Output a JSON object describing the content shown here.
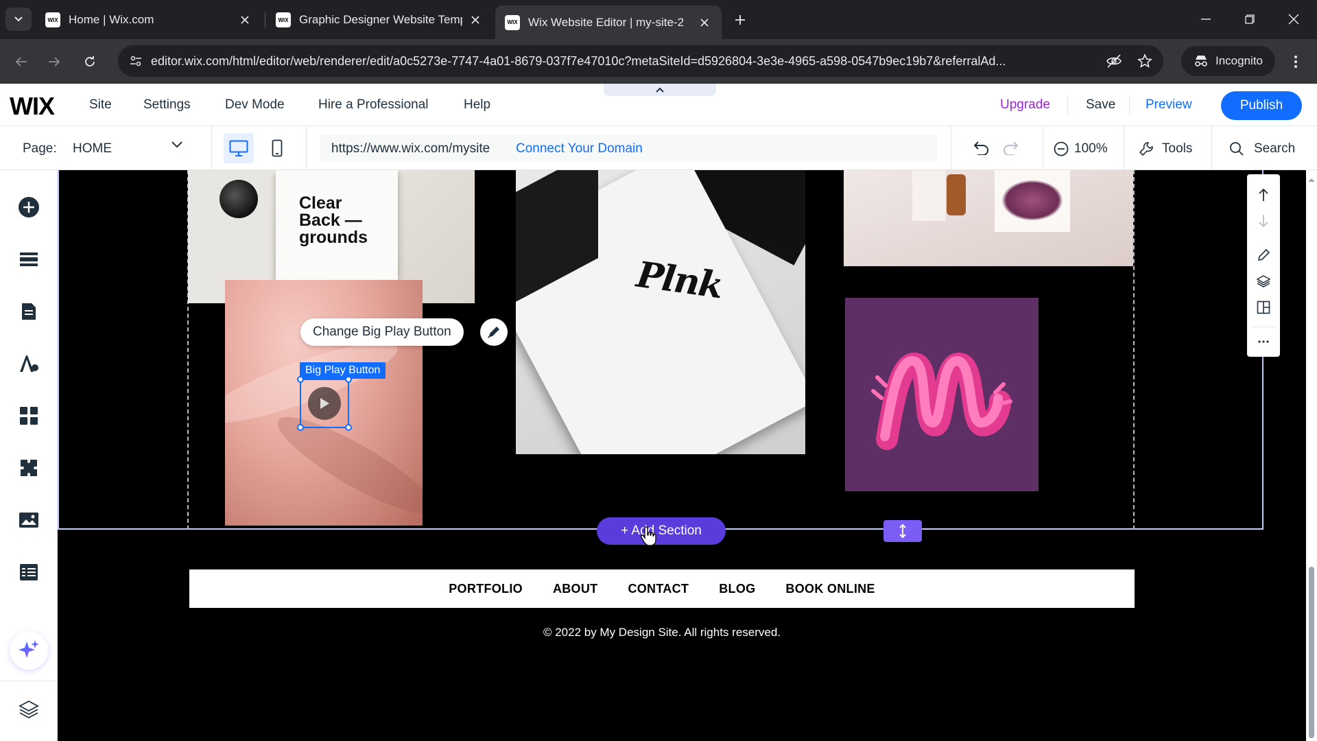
{
  "browser": {
    "tabs": [
      {
        "title": "Home | Wix.com",
        "favicon": "WIX"
      },
      {
        "title": "Graphic Designer Website Temp",
        "favicon": "WIX"
      },
      {
        "title": "Wix Website Editor | my-site-2",
        "favicon": "WIX"
      }
    ],
    "url": "editor.wix.com/html/editor/web/renderer/edit/a0c5273e-7747-4a01-8679-037f7e47010c?metaSiteId=d5926804-3e3e-4965-a598-0547b9ec19b7&referralAd...",
    "incognito_label": "Incognito"
  },
  "wix": {
    "logo": "WIX",
    "menu": [
      "Site",
      "Settings",
      "Dev Mode",
      "Hire a Professional",
      "Help"
    ],
    "upgrade": "Upgrade",
    "save": "Save",
    "preview": "Preview",
    "publish": "Publish"
  },
  "pagebar": {
    "page_label": "Page:",
    "page_name": "HOME",
    "site_url": "https://www.wix.com/mysite",
    "connect_domain": "Connect Your Domain",
    "zoom": "100%",
    "tools": "Tools",
    "search": "Search"
  },
  "canvas": {
    "image_text_clear": "Clear Back — grounds",
    "image_text_signature": "Plnk",
    "selected_element_label": "Big Play Button",
    "change_button_label": "Change Big Play Button",
    "add_section_label": "+ Add Section",
    "footer_nav": [
      "PORTFOLIO",
      "ABOUT",
      "CONTACT",
      "BLOG",
      "BOOK ONLINE"
    ],
    "copyright": "© 2022 by My Design Site. All rights reserved."
  },
  "colors": {
    "accent": "#116dff",
    "upgrade": "#9a27d5",
    "add_section": "#5a3cdc"
  }
}
